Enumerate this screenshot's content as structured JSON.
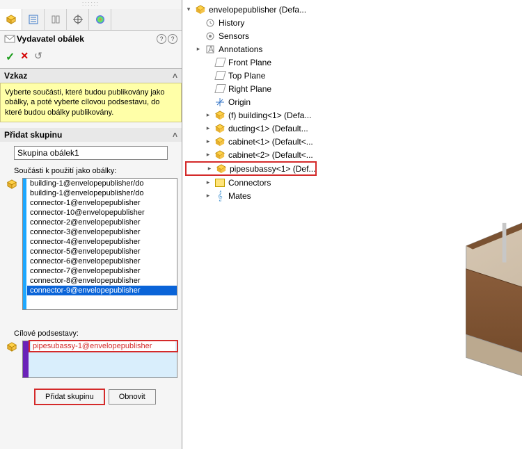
{
  "header": {
    "title": "Vydavatel obálek"
  },
  "sections": {
    "vzkaz_header": "Vzkaz",
    "vzkaz_text": "Vyberte součásti, které budou publikovány jako obálky, a poté vyberte cílovou podsestavu, do které budou obálky publikovány.",
    "pridat_header": "Přidat skupinu",
    "group_name": "Skupina obálek1",
    "components_label": "Součásti k použití jako obálky:",
    "components": [
      "building-1@envelopepublisher/do",
      "building-1@envelopepublisher/do",
      "connector-1@envelopepublisher",
      "connector-10@envelopepublisher",
      "connector-2@envelopepublisher",
      "connector-3@envelopepublisher",
      "connector-4@envelopepublisher",
      "connector-5@envelopepublisher",
      "connector-6@envelopepublisher",
      "connector-7@envelopepublisher",
      "connector-8@envelopepublisher",
      "connector-9@envelopepublisher"
    ],
    "target_label": "Cílové podsestavy:",
    "target_item": "pipesubassy-1@envelopepublisher",
    "btn_add": "Přidat skupinu",
    "btn_refresh": "Obnovit"
  },
  "tree": {
    "root": "envelopepublisher (Defa...",
    "items": [
      {
        "label": "History",
        "icon": "hist"
      },
      {
        "label": "Sensors",
        "icon": "sens"
      },
      {
        "label": "Annotations",
        "icon": "annot",
        "exp": true
      },
      {
        "label": "Front Plane",
        "icon": "plane",
        "indent": 2
      },
      {
        "label": "Top Plane",
        "icon": "plane",
        "indent": 2
      },
      {
        "label": "Right Plane",
        "icon": "plane",
        "indent": 2
      },
      {
        "label": "Origin",
        "icon": "origin",
        "indent": 2
      },
      {
        "label": "(f) building<1> (Defa...",
        "icon": "asm",
        "exp": true,
        "indent": 2
      },
      {
        "label": "ducting<1> (Default...",
        "icon": "asm",
        "exp": true,
        "indent": 2
      },
      {
        "label": "cabinet<1> (Default<...",
        "icon": "asm",
        "exp": true,
        "indent": 2
      },
      {
        "label": "cabinet<2> (Default<...",
        "icon": "asm",
        "exp": true,
        "indent": 2
      },
      {
        "label": "pipesubassy<1> (Def...",
        "icon": "asm",
        "exp": true,
        "indent": 2,
        "highlight": true
      },
      {
        "label": "Connectors",
        "icon": "folder",
        "exp": true,
        "indent": 2
      },
      {
        "label": "Mates",
        "icon": "mates",
        "exp": true,
        "indent": 2
      }
    ]
  }
}
